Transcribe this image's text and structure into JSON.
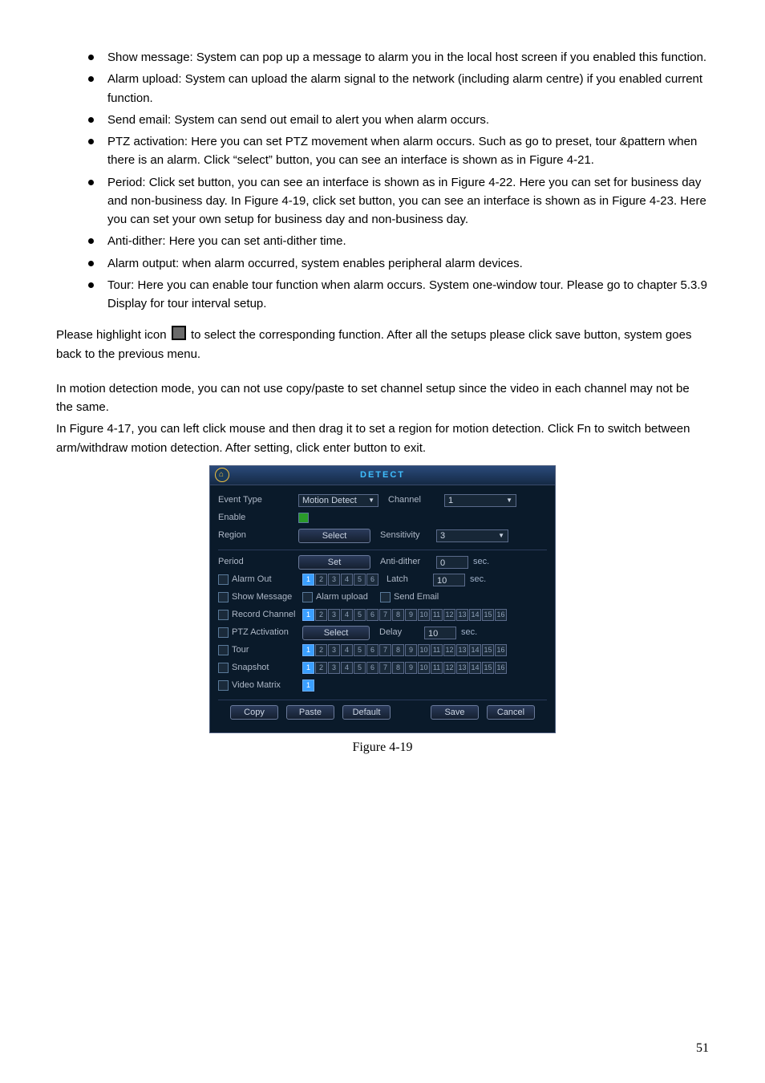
{
  "bullets": [
    "Show message: System can pop up a message to alarm you in the local host screen if you enabled this function.",
    "Alarm upload: System can upload the alarm signal to the network (including alarm centre) if you enabled current function.",
    "Send email: System can send out email to alert you when alarm occurs.",
    "PTZ activation: Here you can set PTZ movement when alarm occurs. Such as go to preset, tour &pattern when there is an alarm. Click “select” button, you can see an interface is shown as in Figure 4-21.",
    "Period: Click set button, you can see an interface is shown as in Figure 4-22. Here you can set for business day and non-business day. In Figure 4-19, click set button, you can see an interface is shown as in Figure 4-23. Here you can set your own setup for business day and non-business day.",
    "Anti-dither: Here you can set anti-dither time.",
    "Alarm output: when alarm occurred, system enables peripheral alarm devices.",
    "Tour: Here you can enable tour function when alarm occurs.  System one-window tour. Please go to chapter 5.3.9 Display for tour interval setup."
  ],
  "p1a": "Please highlight icon ",
  "p1b": " to select the corresponding function. After all the setups please click save button, system goes back to the previous menu.",
  "p2": "In motion detection mode, you can not use copy/paste to set channel setup since the video in each channel may not be the same.",
  "p3": "In Figure 4-17, you can left click mouse and then drag it to set a region for motion detection. Click Fn to switch between arm/withdraw motion detection. After setting, click enter button to exit.",
  "detect": {
    "title": "DETECT",
    "event_type_label": "Event Type",
    "event_type_value": "Motion Detect",
    "channel_label": "Channel",
    "channel_value": "1",
    "enable_label": "Enable",
    "region_label": "Region",
    "select_btn": "Select",
    "sensitivity_label": "Sensitivity",
    "sensitivity_value": "3",
    "period_label": "Period",
    "set_btn": "Set",
    "antidither_label": "Anti-dither",
    "antidither_value": "0",
    "sec": "sec.",
    "alarm_out_label": "Alarm Out",
    "latch_label": "Latch",
    "latch_value": "10",
    "show_message": "Show Message",
    "alarm_upload": "Alarm upload",
    "send_email": "Send Email",
    "record_channel": "Record Channel",
    "ptz_activation": "PTZ Activation",
    "delay_label": "Delay",
    "delay_value": "10",
    "tour": "Tour",
    "snapshot": "Snapshot",
    "video_matrix": "Video Matrix",
    "copy": "Copy",
    "paste": "Paste",
    "default": "Default",
    "save": "Save",
    "cancel": "Cancel"
  },
  "caption": "Figure 4-19",
  "page_number": "51"
}
